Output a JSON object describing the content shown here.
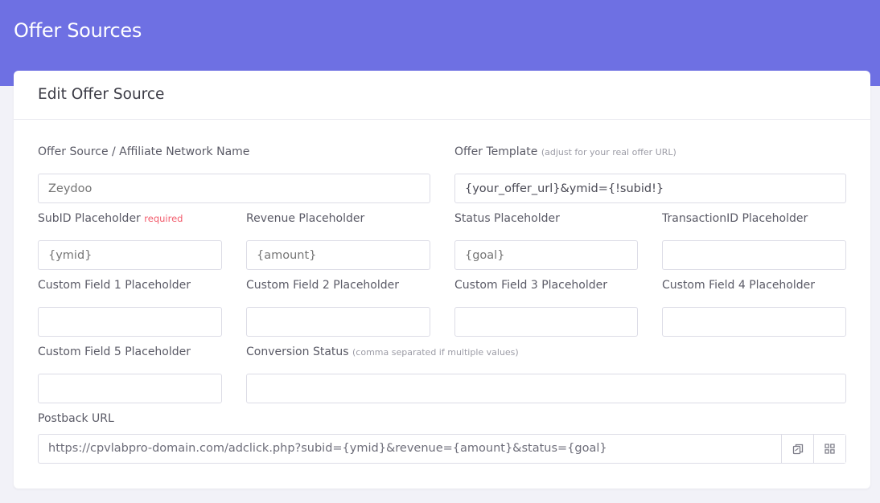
{
  "header": {
    "title": "Offer Sources"
  },
  "card": {
    "title": "Edit Offer Source"
  },
  "fields": {
    "network_name": {
      "label": "Offer Source / Affiliate Network Name",
      "placeholder": "Zeydoo"
    },
    "offer_template": {
      "label": "Offer Template",
      "hint": "(adjust for your real offer URL)",
      "value": "{your_offer_url}&ymid={!subid!}"
    },
    "subid": {
      "label": "SubID Placeholder",
      "required": "required",
      "placeholder": "{ymid}"
    },
    "revenue": {
      "label": "Revenue Placeholder",
      "placeholder": "{amount}"
    },
    "status": {
      "label": "Status Placeholder",
      "placeholder": "{goal}"
    },
    "transaction": {
      "label": "TransactionID Placeholder",
      "placeholder": ""
    },
    "custom1": {
      "label": "Custom Field 1 Placeholder",
      "placeholder": ""
    },
    "custom2": {
      "label": "Custom Field 2 Placeholder",
      "placeholder": ""
    },
    "custom3": {
      "label": "Custom Field 3 Placeholder",
      "placeholder": ""
    },
    "custom4": {
      "label": "Custom Field 4 Placeholder",
      "placeholder": ""
    },
    "custom5": {
      "label": "Custom Field 5 Placeholder",
      "placeholder": ""
    },
    "conversion_status": {
      "label": "Conversion Status",
      "hint": "(comma separated if multiple values)",
      "placeholder": ""
    },
    "postback": {
      "label": "Postback URL",
      "value": "https://cpvlabpro-domain.com/adclick.php?subid={ymid}&revenue={amount}&status={goal}"
    }
  },
  "icons": {
    "copy": "copy-icon",
    "qr": "qr-code-icon"
  },
  "colors": {
    "header_bg": "#6e70e3",
    "required": "#f25c6c"
  }
}
